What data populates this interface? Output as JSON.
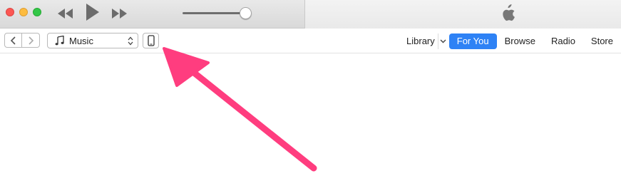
{
  "window": {
    "controls": [
      "close",
      "minimize",
      "zoom"
    ]
  },
  "player": {
    "buttons": [
      "rewind-icon",
      "play-icon",
      "fast-forward-icon"
    ],
    "volume_level": 0.92,
    "lcd_icon": "apple-logo"
  },
  "toolbar": {
    "back_icon": "chevron-left-icon",
    "forward_icon": "chevron-right-icon",
    "media_select": {
      "icon": "music-note-icon",
      "value": "Music"
    },
    "device_icon": "iphone-icon",
    "tabs": [
      {
        "label": "Library",
        "active": false
      },
      {
        "label": "For You",
        "active": true
      },
      {
        "label": "Browse",
        "active": false
      },
      {
        "label": "Radio",
        "active": false
      },
      {
        "label": "Store",
        "active": false
      }
    ]
  },
  "annotation": {
    "arrow_color": "#ff3d7f"
  },
  "colors": {
    "accent": "#2e82f5",
    "arrow": "#ff3d7f"
  }
}
